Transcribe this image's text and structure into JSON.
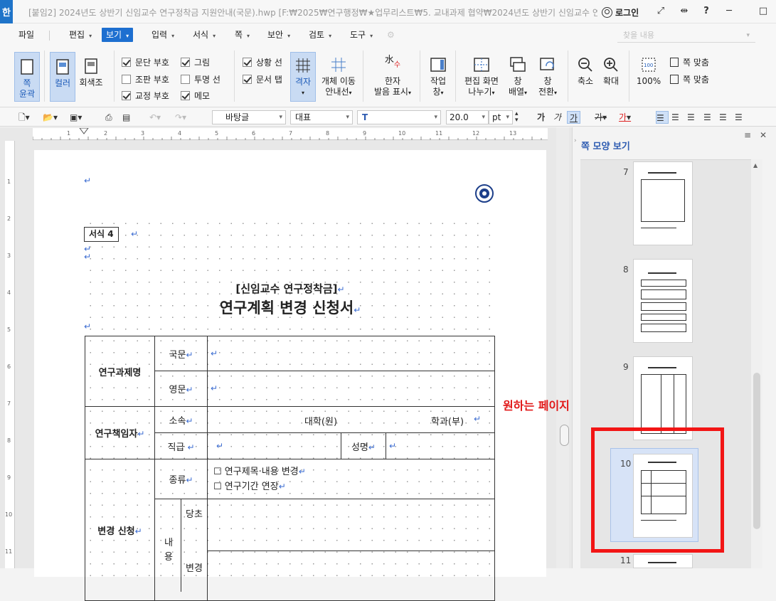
{
  "titlebar": {
    "logo_char": "한",
    "title": "[붙임2] 2024년도 상반기 신임교수 연구정착금 지원안내(국문).hwp [F:₩2025₩연구행정₩★업무리스트₩5. 교내과제 협약₩2024년도 상반기 신임교수 연...",
    "login_label": "로그인",
    "help_glyph": "?"
  },
  "menu": {
    "items": [
      "파일",
      "편집",
      "보기",
      "입력",
      "서식",
      "쪽",
      "보안",
      "검토",
      "도구"
    ],
    "active": "보기",
    "search_placeholder": "찾을 내용"
  },
  "ribbon": {
    "page_outline": [
      "쪽",
      "윤곽"
    ],
    "color": "컬러",
    "grayscale": "회색조",
    "checks": [
      {
        "label": "문단 부호",
        "checked": true
      },
      {
        "label": "그림",
        "checked": true
      },
      {
        "label": "조판 부호",
        "checked": false
      },
      {
        "label": "투명 선",
        "checked": false
      },
      {
        "label": "교정 부호",
        "checked": true
      },
      {
        "label": "메모",
        "checked": true
      },
      {
        "label": "상황 선",
        "checked": true
      },
      {
        "label": "문서 탭",
        "checked": true
      }
    ],
    "grid": "격자",
    "object_move": [
      "개체 이동",
      "안내선"
    ],
    "hanja": [
      "한자",
      "발음 표시"
    ],
    "work_window": [
      "작업",
      "창"
    ],
    "edit_screen": [
      "편집 화면",
      "나누기"
    ],
    "window_arrange": [
      "창",
      "배열"
    ],
    "window_switch": [
      "창",
      "전환"
    ],
    "zoom_out": "축소",
    "zoom_in": "확대",
    "zoom_100": "100%",
    "fit_page_1": "쪽 맞춤",
    "fit_page_2": "쪽 맞춤"
  },
  "format_toolbar": {
    "style": "바탕글",
    "font_lang": "대표",
    "font": "",
    "size": "20.0",
    "unit": "pt",
    "bold_glyph": "가",
    "italic_glyph": "가",
    "underline_glyph": "가",
    "strike_glyph": "가",
    "color_glyph": "가"
  },
  "document": {
    "form_tag": "서식 4",
    "subtitle": "[신임교수 연구정착금]",
    "title": "연구계획 변경 신청서",
    "rows": {
      "project_name": "연구과제명",
      "korean": "국문",
      "english": "영문",
      "pi": "연구책임자",
      "affiliation": "소속",
      "univ": "대학(원)",
      "dept": "학과(부)",
      "position": "직급",
      "name": "성명",
      "change_request": "변경 신청",
      "type": "종류",
      "type_opt1": "☐ 연구제목·내용 변경",
      "type_opt2": "☐ 연구기간 연장",
      "content": "내용",
      "original": "당초",
      "changed": "변경"
    },
    "return_mark": "↵"
  },
  "annotation": "원하는 페이지 선택",
  "right_panel": {
    "title": "쪽 모양 보기",
    "pages": [
      "7",
      "8",
      "9",
      "10",
      "11"
    ],
    "selected_page": "10"
  }
}
